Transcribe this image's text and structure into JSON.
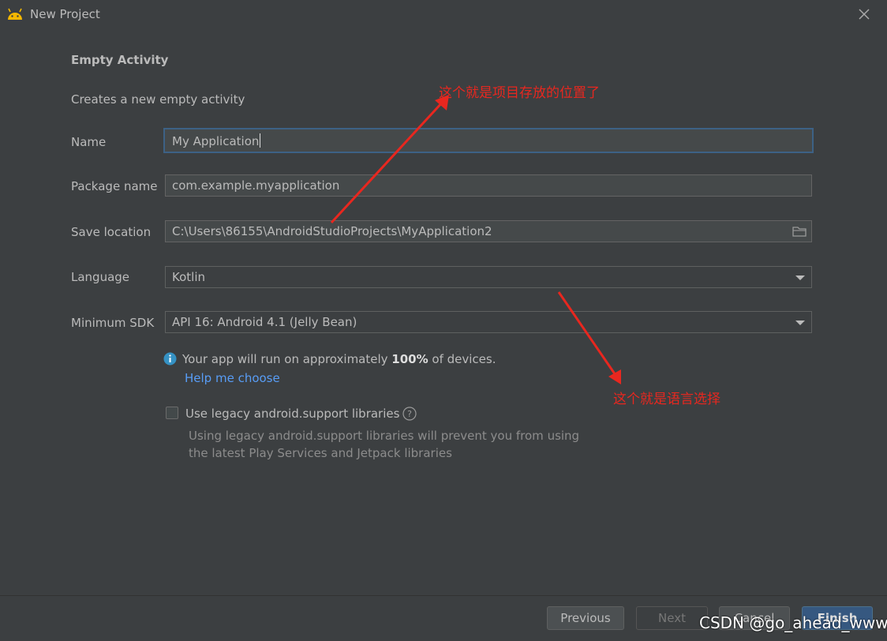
{
  "window": {
    "title": "New Project"
  },
  "header": {
    "heading": "Empty Activity",
    "description": "Creates a new empty activity"
  },
  "form": {
    "name_label": "Name",
    "name_value": "My Application",
    "package_label": "Package name",
    "package_value": "com.example.myapplication",
    "location_label": "Save location",
    "location_value": "C:\\Users\\86155\\AndroidStudioProjects\\MyApplication2",
    "language_label": "Language",
    "language_value": "Kotlin",
    "sdk_label": "Minimum SDK",
    "sdk_value": "API 16: Android 4.1 (Jelly Bean)"
  },
  "info": {
    "prefix": "Your app will run on approximately ",
    "percent": "100%",
    "suffix": " of devices.",
    "help_link": "Help me choose"
  },
  "legacy": {
    "label": "Use legacy android.support libraries",
    "note_line1": "Using legacy android.support libraries will prevent you from using",
    "note_line2": "the latest Play Services and Jetpack libraries",
    "checked": false
  },
  "annotations": {
    "location_note": "这个就是项目存放的位置了",
    "language_note": "这个就是语言选择"
  },
  "footer": {
    "previous": "Previous",
    "next": "Next",
    "cancel": "Cancel",
    "finish": "Finish"
  },
  "watermark": "CSDN @go_ahead_www",
  "colors": {
    "background": "#3c3f41",
    "accent": "#365880",
    "link": "#589df6",
    "annotation": "#e8271f",
    "focus_border": "#3d6185"
  }
}
